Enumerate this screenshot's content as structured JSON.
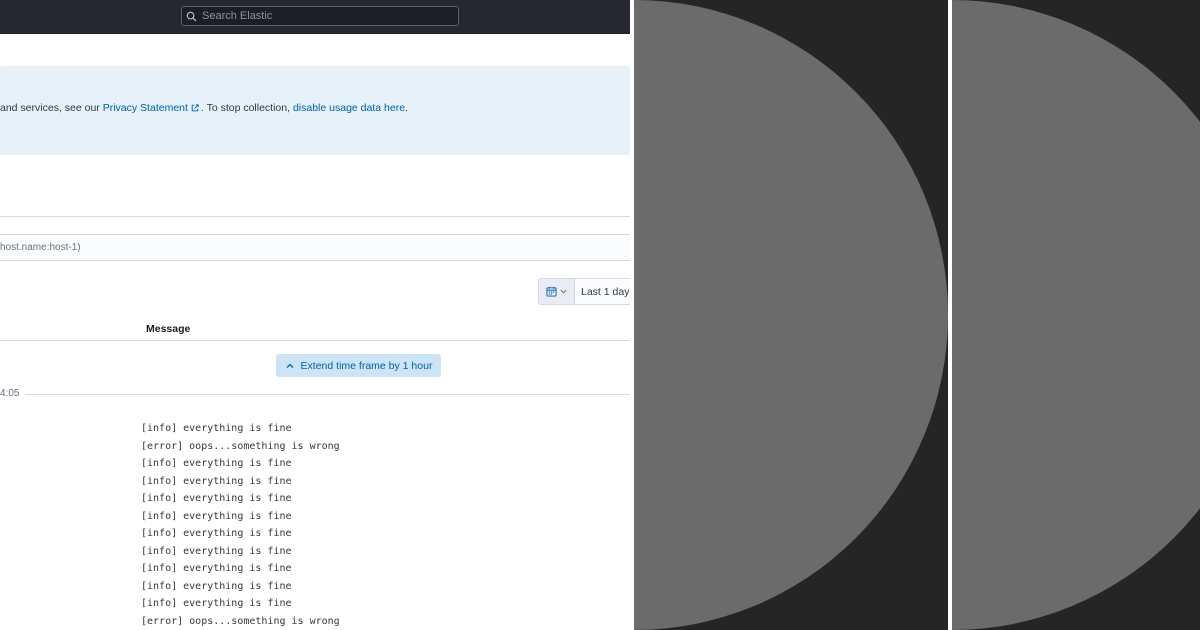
{
  "search": {
    "placeholder": "Search Elastic"
  },
  "callout": {
    "text_before": "and services, see our ",
    "privacy_link": "Privacy Statement",
    "text_middle": ". To stop collection, ",
    "disable_link": "disable usage data here",
    "text_after": "."
  },
  "query": {
    "text": "host.name:host-1)"
  },
  "datepicker": {
    "label": "Last 1 day"
  },
  "table": {
    "message_header": "Message"
  },
  "extend": {
    "label": "Extend time frame by 1 hour"
  },
  "timestamp": "4:05",
  "logs": [
    "[info] everything is fine",
    "[error] oops...something is wrong",
    "[info] everything is fine",
    "[info] everything is fine",
    "[info] everything is fine",
    "[info] everything is fine",
    "[info] everything is fine",
    "[info] everything is fine",
    "[info] everything is fine",
    "[info] everything is fine",
    "[info] everything is fine",
    "[error] oops...something is wrong"
  ],
  "colors": {
    "topbar": "#25282f",
    "callout_bg": "#e6f1fa",
    "link": "#0061a6",
    "extend_bg": "#cce4f5",
    "panel_bg": "#252525",
    "circle": "#6b6b6b"
  },
  "icons": [
    "search-icon",
    "external-link-icon",
    "calendar-icon",
    "chevron-down-icon",
    "chevron-up-icon"
  ]
}
